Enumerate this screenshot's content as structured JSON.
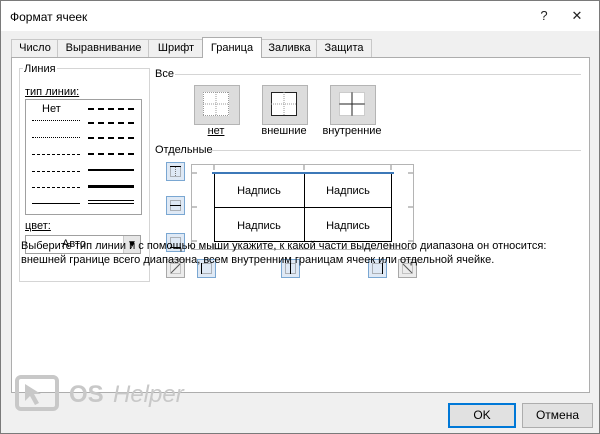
{
  "dialog": {
    "title": "Формат ячеек",
    "help_symbol": "?",
    "close_symbol": "✕"
  },
  "tabs": [
    {
      "label": "Число",
      "active": false
    },
    {
      "label": "Выравнивание",
      "active": false
    },
    {
      "label": "Шрифт",
      "active": false
    },
    {
      "label": "Граница",
      "active": true
    },
    {
      "label": "Заливка",
      "active": false
    },
    {
      "label": "Защита",
      "active": false
    }
  ],
  "line_group": {
    "legend": "Линия",
    "type_label": "тип линии:",
    "none_label": "Нет",
    "color_label": "цвет:",
    "color_value": "Авто"
  },
  "presets": {
    "header": "Все",
    "items": [
      {
        "label": "нет",
        "icon": "border-none-icon"
      },
      {
        "label": "внешние",
        "icon": "border-outline-icon"
      },
      {
        "label": "внутренние",
        "icon": "border-inside-icon"
      }
    ]
  },
  "individual": {
    "header": "Отдельные",
    "cells": [
      "Надпись",
      "Надпись",
      "Надпись",
      "Надпись"
    ]
  },
  "description": "Выберите тип линии и с помощью мыши укажите, к какой части выделенного диапазона он относится: внешней границе всего диапазона, всем внутренним границам ячеек или отдельной ячейке.",
  "watermark": {
    "text_part1": "OS",
    "text_part2": "Helper"
  },
  "buttons": {
    "ok": "OK",
    "cancel": "Отмена"
  },
  "colors": {
    "accent": "#0078d7",
    "preview_top_border": "#3c78b8",
    "logo": "#c8c8c8"
  }
}
